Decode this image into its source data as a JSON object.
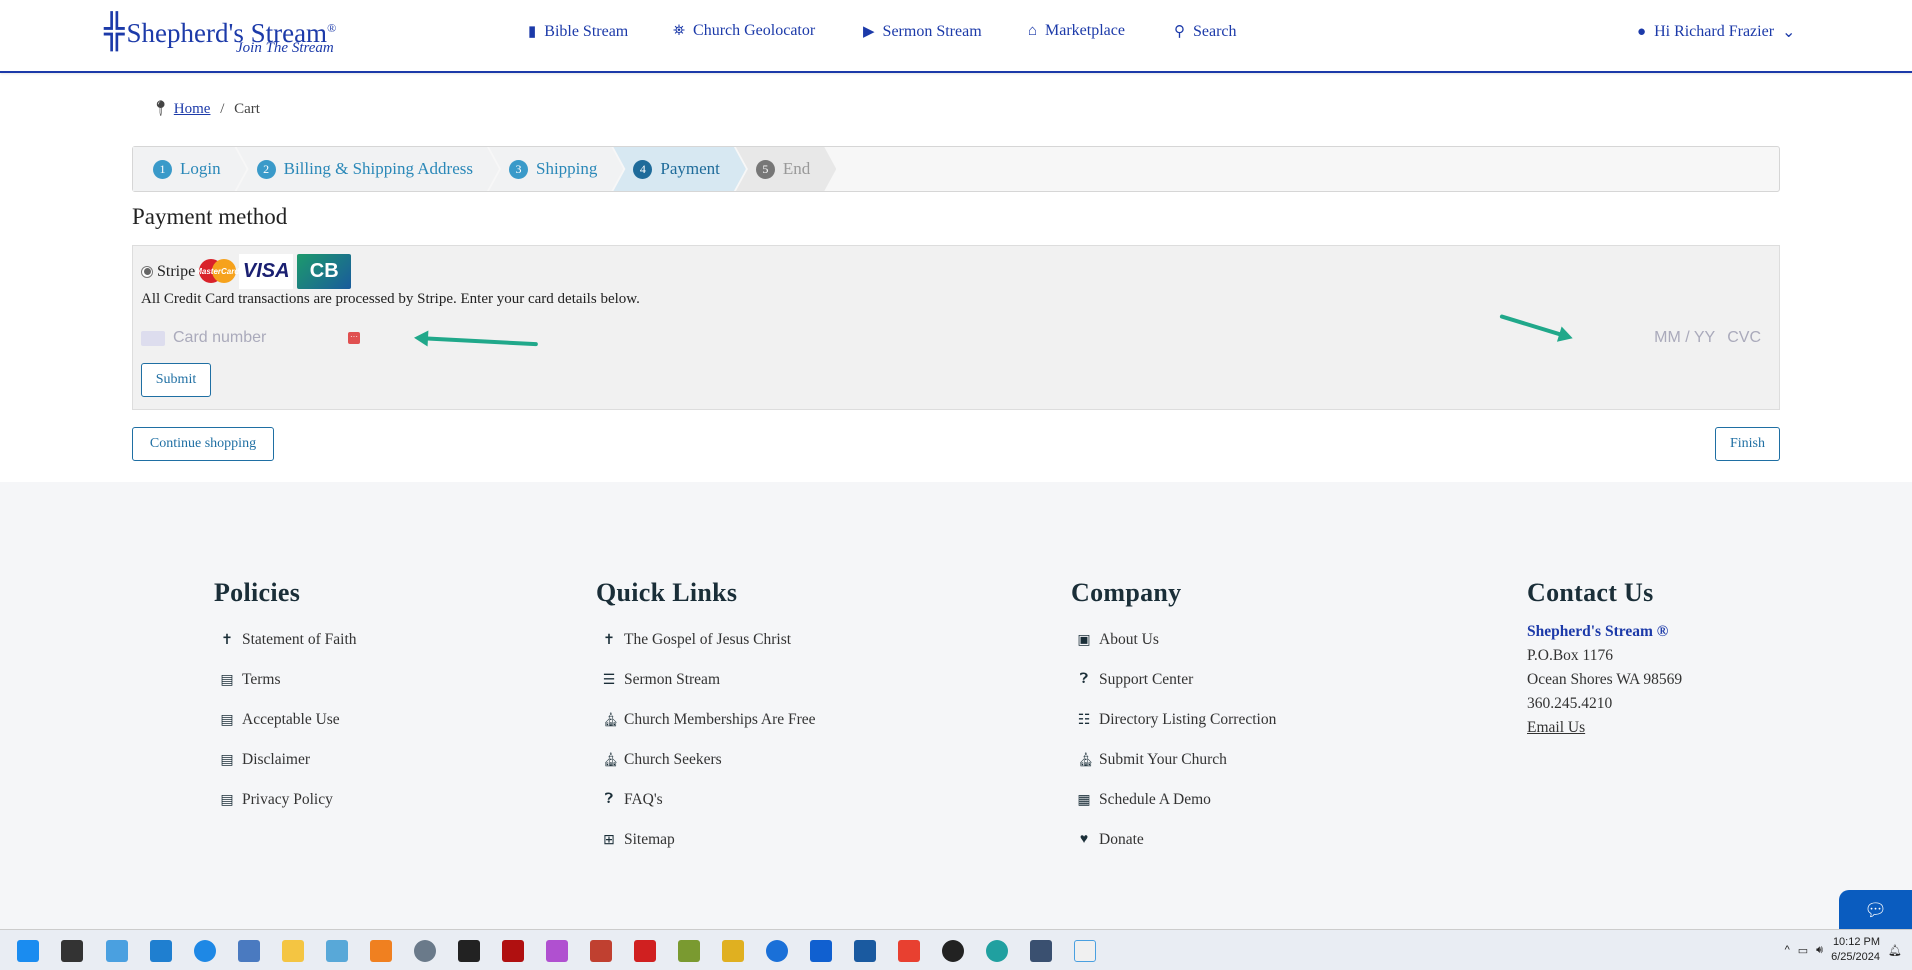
{
  "header": {
    "logo_name": "Shepherd's Stream",
    "logo_reg": "®",
    "logo_tagline": "Join The Stream",
    "nav": [
      {
        "label": "Bible Stream",
        "icon": "book-icon"
      },
      {
        "label": "Church Geolocator",
        "icon": "map-icon"
      },
      {
        "label": "Sermon Stream",
        "icon": "play-icon"
      },
      {
        "label": "Marketplace",
        "icon": "store-icon"
      },
      {
        "label": "Search",
        "icon": "search-icon"
      }
    ],
    "user": "Hi Richard Frazier"
  },
  "breadcrumb": {
    "home": "Home",
    "sep": "/",
    "current": "Cart"
  },
  "steps": [
    {
      "num": "1",
      "label": "Login"
    },
    {
      "num": "2",
      "label": "Billing & Shipping Address"
    },
    {
      "num": "3",
      "label": "Shipping"
    },
    {
      "num": "4",
      "label": "Payment"
    },
    {
      "num": "5",
      "label": "End"
    }
  ],
  "payment": {
    "title": "Payment method",
    "method": "Stripe",
    "cards": {
      "mastercard": "MasterCard",
      "visa": "VISA",
      "cb": "CB"
    },
    "note": "All Credit Card transactions are processed by Stripe. Enter your card details below.",
    "card_placeholder": "Card number",
    "exp_placeholder": "MM / YY",
    "cvc_placeholder": "CVC",
    "submit": "Submit"
  },
  "actions": {
    "continue": "Continue shopping",
    "finish": "Finish"
  },
  "footer": {
    "policies": {
      "title": "Policies",
      "links": [
        "Statement of Faith",
        "Terms",
        "Acceptable Use",
        "Disclaimer",
        "Privacy Policy"
      ]
    },
    "quick": {
      "title": "Quick Links",
      "links": [
        "The Gospel of Jesus Christ",
        "Sermon Stream",
        "Church Memberships Are Free",
        "Church Seekers",
        "FAQ's",
        "Sitemap"
      ]
    },
    "company": {
      "title": "Company",
      "links": [
        "About Us",
        "Support Center",
        "Directory Listing Correction",
        "Submit Your Church",
        "Schedule A Demo",
        "Donate"
      ]
    },
    "contact": {
      "title": "Contact Us",
      "brand": "Shepherd's Stream ®",
      "po": "P.O.Box 1176",
      "city": "Ocean Shores WA 98569",
      "phone": "360.245.4210",
      "email": "Email Us"
    }
  },
  "taskbar": {
    "time": "10:12 PM",
    "date": "6/25/2024"
  }
}
